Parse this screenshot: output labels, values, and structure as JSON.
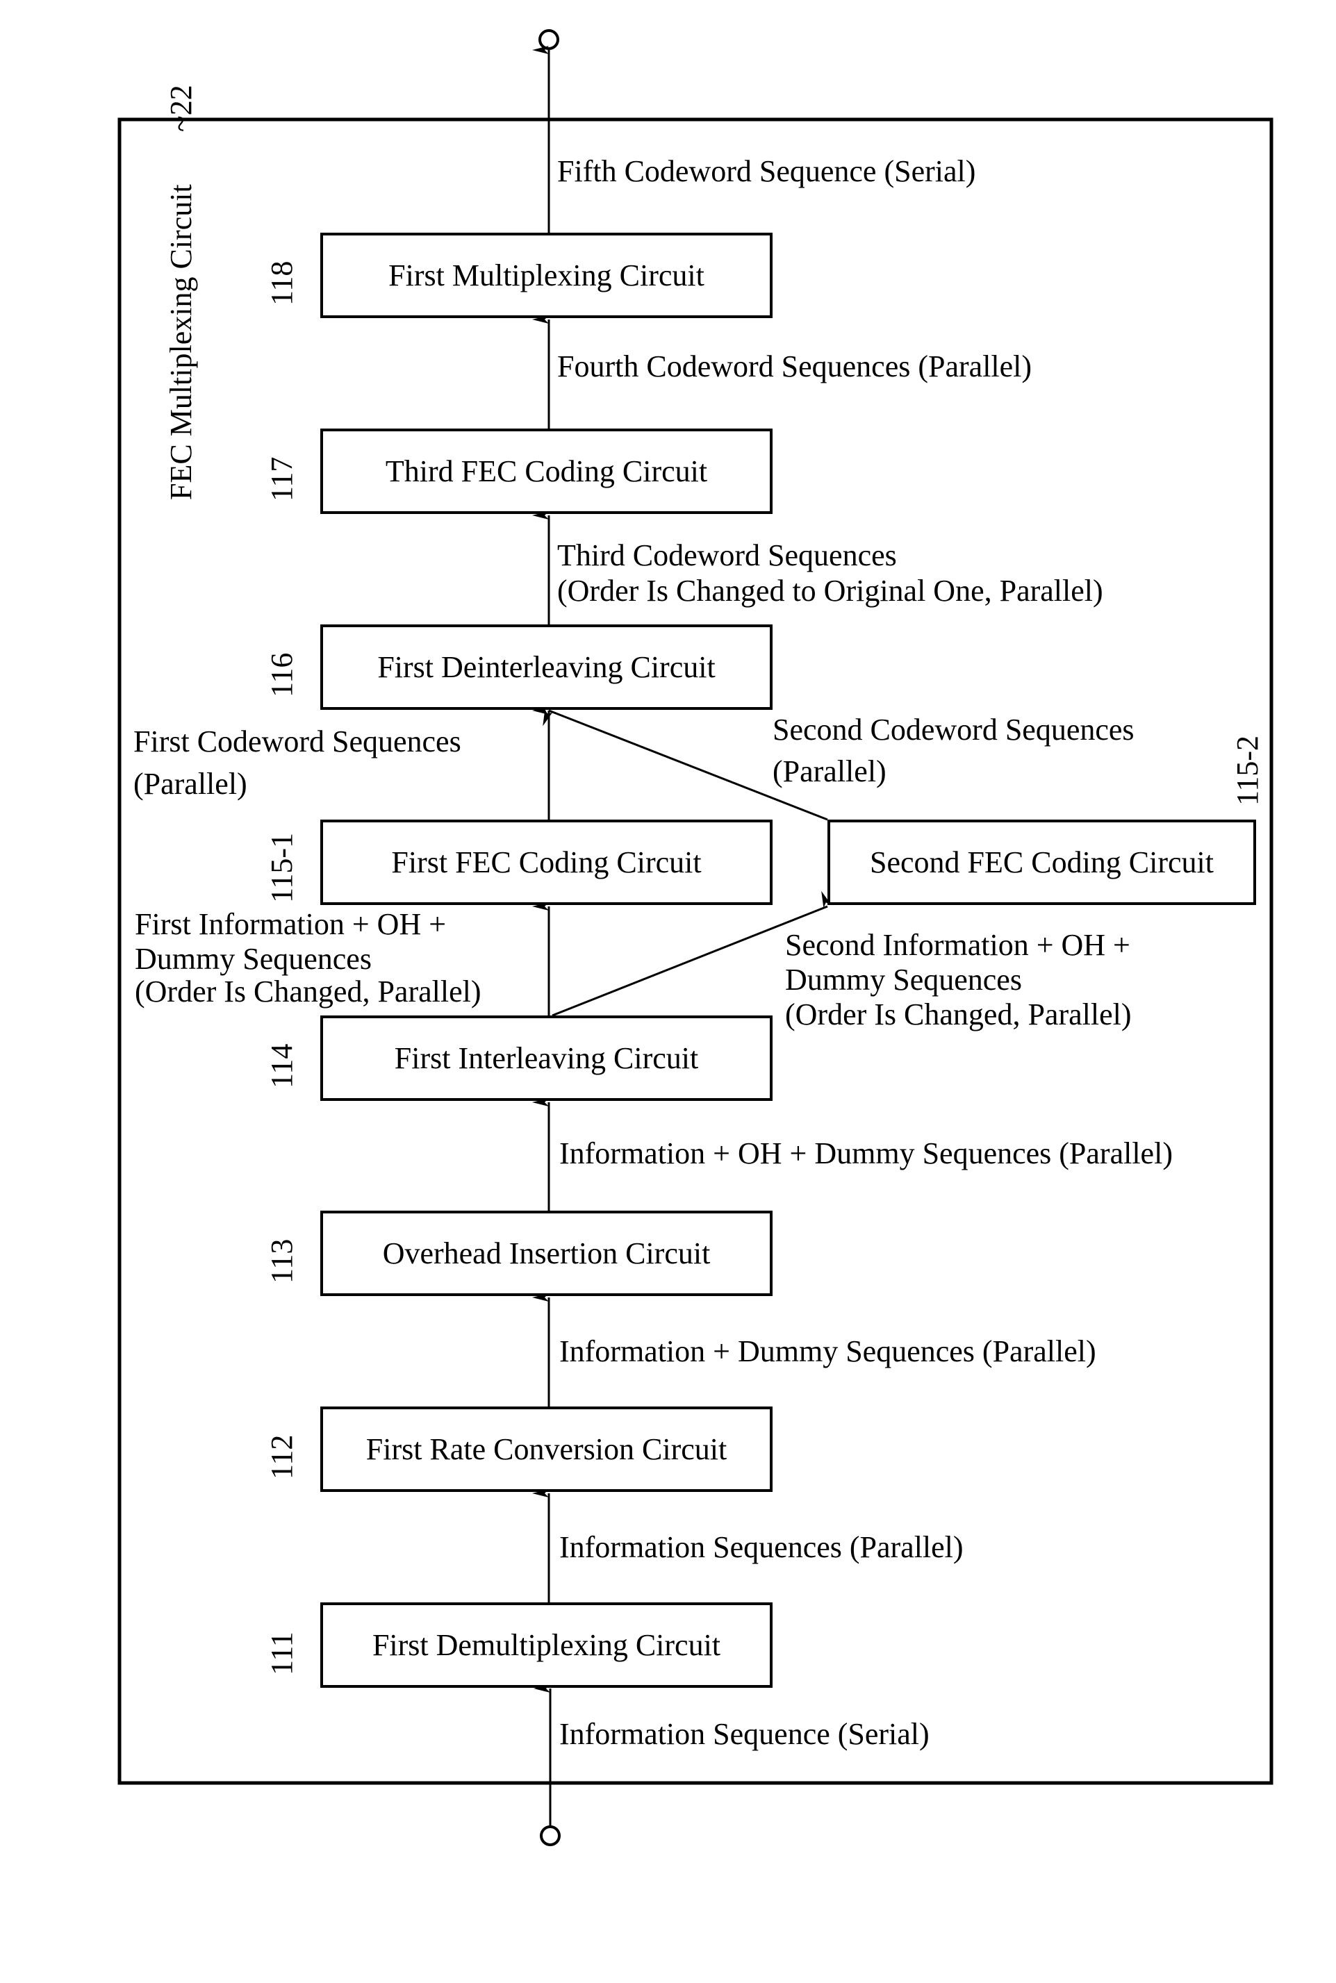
{
  "frame": {
    "title": "FEC Multiplexing Circuit",
    "ref": "~22"
  },
  "blocks": [
    {
      "ref": "118",
      "label": "First Multiplexing Circuit"
    },
    {
      "ref": "117",
      "label": "Third FEC Coding Circuit"
    },
    {
      "ref": "116",
      "label": "First Deinterleaving Circuit"
    },
    {
      "ref": "115-1",
      "label": "First FEC Coding Circuit"
    },
    {
      "ref": "115-2",
      "label": "Second FEC Coding Circuit"
    },
    {
      "ref": "114",
      "label": "First Interleaving Circuit"
    },
    {
      "ref": "113",
      "label": "Overhead Insertion Circuit"
    },
    {
      "ref": "112",
      "label": "First Rate Conversion Circuit"
    },
    {
      "ref": "111",
      "label": "First Demultiplexing Circuit"
    }
  ],
  "signals": {
    "out": "Fifth Codeword Sequence (Serial)",
    "s118_in": "Fourth Codeword Sequences (Parallel)",
    "s117_in_1": "Third Codeword Sequences",
    "s117_in_2": "(Order Is Changed to Original One, Parallel)",
    "s116_in_a1": "First Codeword Sequences",
    "s116_in_a2": "(Parallel)",
    "s116_in_b1": "Second Codeword Sequences",
    "s116_in_b2": "(Parallel)",
    "s1151_in_1": "First Information + OH +",
    "s1151_in_2": "Dummy Sequences",
    "s1151_in_3": "(Order Is Changed, Parallel)",
    "s1152_in_1": "Second Information + OH +",
    "s1152_in_2": "Dummy Sequences",
    "s1152_in_3": "(Order Is Changed, Parallel)",
    "s114_in": "Information + OH + Dummy Sequences (Parallel)",
    "s113_in": "Information + Dummy Sequences (Parallel)",
    "s112_in": "Information Sequences (Parallel)",
    "in": "Information Sequence (Serial)"
  }
}
